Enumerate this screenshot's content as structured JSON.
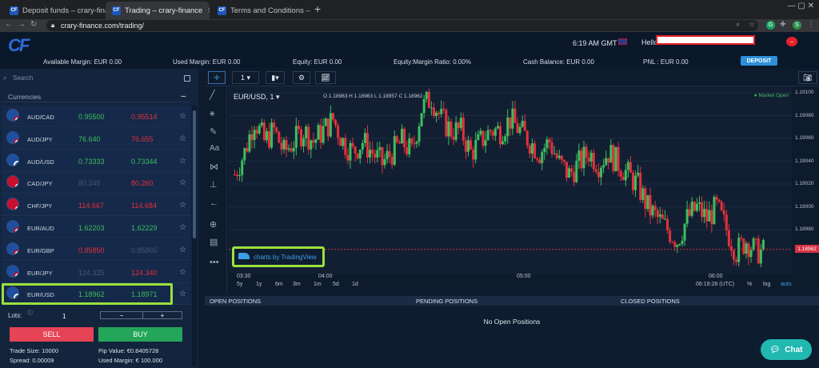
{
  "browser": {
    "tabs": [
      {
        "label": "Deposit funds – crary-finar"
      },
      {
        "label": "Trading – crary-finance"
      },
      {
        "label": "Terms and Conditions – c"
      }
    ],
    "new_tab": "+",
    "window_controls": "—   ▢   ✕",
    "url": "crary-finance.com/trading/"
  },
  "header": {
    "logo": "CF",
    "clock": "6:19 AM GMT",
    "hello": "Hello"
  },
  "stats": {
    "available_margin": "Available Margin: EUR 0.00",
    "used_margin": "Used Margin: EUR 0.00",
    "equity": "Equity: EUR 0.00",
    "equity_margin_ratio": "Equity:Margin Ratio: 0.00%",
    "cash_balance": "Cash Balance: EUR 0.00",
    "pnl": "PNL : EUR 0.00",
    "deposit_label": "DEPOSIT"
  },
  "left": {
    "search_placeholder": "Search",
    "currencies_label": "Currencies",
    "collapse": "–",
    "pairs": [
      {
        "sym": "AUD/CAD",
        "bid": "0.95500",
        "ask": "0.95514",
        "bidc": "g",
        "askc": "r"
      },
      {
        "sym": "AUD/JPY",
        "bid": "76.640",
        "ask": "76.655",
        "bidc": "g",
        "askc": "r"
      },
      {
        "sym": "AUD/USD",
        "bid": "0.73333",
        "ask": "0.73344",
        "bidc": "g",
        "askc": "g"
      },
      {
        "sym": "CAD/JPY",
        "bid": "80.245",
        "ask": "80.260",
        "bidc": "dim",
        "askc": "r"
      },
      {
        "sym": "CHF/JPY",
        "bid": "114.667",
        "ask": "114.684",
        "bidc": "r",
        "askc": "r"
      },
      {
        "sym": "EUR/AUD",
        "bid": "1.62203",
        "ask": "1.62229",
        "bidc": "g",
        "askc": "g"
      },
      {
        "sym": "EUR/GBP",
        "bid": "0.85850",
        "ask": "0.85865",
        "bidc": "r",
        "askc": "dim"
      },
      {
        "sym": "EUR/JPY",
        "bid": "124.325",
        "ask": "124.340",
        "bidc": "dim",
        "askc": "r"
      },
      {
        "sym": "EUR/USD",
        "bid": "1.18962",
        "ask": "1.18971",
        "bidc": "g",
        "askc": "g"
      }
    ],
    "star": "☆",
    "lots_label": "Lots:",
    "lots_value": "1",
    "minus": "−",
    "plus": "+",
    "sell": "SELL",
    "buy": "BUY",
    "trade_size": "Trade Size: 10000",
    "spread": "Spread: 0.00009",
    "pip_value": "Pip Value: €0.8405728",
    "used_margin": "Used Margin: € 100.000"
  },
  "chart_toolbar": {
    "interval": "1",
    "symbol_label": "EUR/USD, 1",
    "ohlc": "O 1.18963 H 1.18963 L 1.18957 C 1.18962",
    "market_status": "● Market Open",
    "tv_badge": "charts by TradingView"
  },
  "chart_bottom": {
    "ranges": [
      "5y",
      "1y",
      "6m",
      "3m",
      "1m",
      "5d",
      "1d"
    ],
    "time": "06:19:28 (UTC)",
    "percent": "%",
    "log": "log",
    "auto": "auto"
  },
  "positions": {
    "open": "OPEN POSITIONS",
    "pending": "PENDING POSITIONS",
    "closed": "CLOSED POSITIONS",
    "empty": "No Open Positions"
  },
  "chat": "Chat",
  "chart_data": {
    "type": "line",
    "ylim": [
      1.1894,
      1.1911
    ],
    "y_ticks": [
      "1.19100",
      "1.19080",
      "1.19060",
      "1.19040",
      "1.19020",
      "1.19000",
      "1.18980"
    ],
    "x_ticks": [
      "03:30",
      "04:00",
      "05:00",
      "06:00"
    ],
    "last_price": "1.18962",
    "series": [
      {
        "values": [
          1.1903,
          1.1905,
          1.1908,
          1.1906,
          1.1907,
          1.1905,
          1.1906,
          1.1907,
          1.1906,
          1.1907,
          1.1908,
          1.1906,
          1.1905,
          1.1906,
          1.1905,
          1.1904,
          1.1905,
          1.1906,
          1.1905,
          1.1909,
          1.191,
          1.1908,
          1.1907,
          1.1907,
          1.1905,
          1.1906,
          1.1907,
          1.1907,
          1.1908,
          1.1907,
          1.1906,
          1.1905,
          1.1906,
          1.1904,
          1.1903,
          1.1904,
          1.1905,
          1.1904,
          1.1905,
          1.1904,
          1.1903,
          1.1902,
          1.19,
          1.1899,
          1.1898,
          1.1897,
          1.1899,
          1.19,
          1.1899,
          1.19,
          1.1898,
          1.1896,
          1.1897,
          1.1896
        ]
      }
    ]
  }
}
